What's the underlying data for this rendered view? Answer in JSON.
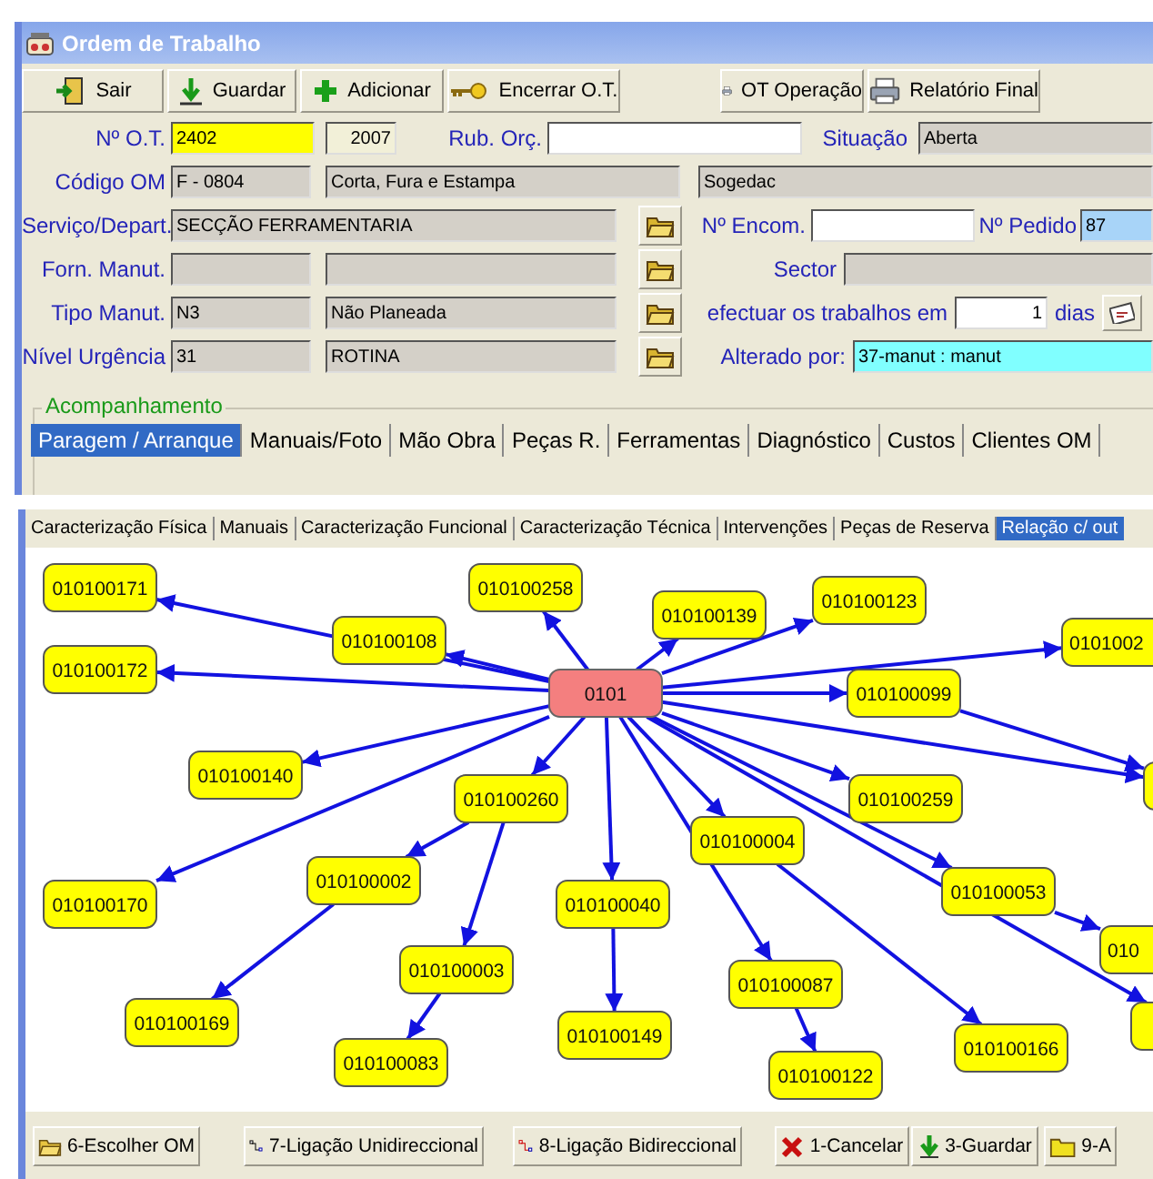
{
  "window": {
    "title": "Ordem de Trabalho"
  },
  "toolbar": [
    {
      "label": "Sair"
    },
    {
      "label": "Guardar"
    },
    {
      "label": "Adicionar"
    },
    {
      "label": "Encerrar O.T."
    },
    {
      "label": "OT Operação"
    },
    {
      "label": "Relatório Final"
    }
  ],
  "form": {
    "ot_number": {
      "label": "Nº O.T.",
      "value": "2402"
    },
    "year": "2007",
    "rub_orc": {
      "label": "Rub. Orç."
    },
    "situacao": {
      "label": "Situação",
      "value": "Aberta"
    },
    "codigo_om": {
      "label": "Código OM",
      "code": "F - 0804",
      "name": "Corta, Fura e Estampa",
      "client": "Sogedac"
    },
    "servico": {
      "label": "Serviço/Depart.",
      "value": "SECÇÃO FERRAMENTARIA"
    },
    "encomenda": {
      "label": "Nº Encom."
    },
    "pedido": {
      "label": "Nº Pedido",
      "value": "87"
    },
    "fornecedor": {
      "label": "Forn. Manut."
    },
    "sector": {
      "label": "Sector"
    },
    "tipo": {
      "label": "Tipo Manut.",
      "code": "N3",
      "name": "Não Planeada"
    },
    "prazo": {
      "label": "efectuar os trabalhos em",
      "value": "1",
      "unit": "dias"
    },
    "urgencia": {
      "label": "Nível Urgência",
      "code": "31",
      "name": "ROTINA"
    },
    "alterado": {
      "label": "Alterado por:",
      "value": "37-manut : manut"
    }
  },
  "tracking": {
    "title": "Acompanhamento",
    "tabs": [
      {
        "label": "Paragem / Arranque",
        "selected": true
      },
      {
        "label": "Manuais/Foto",
        "selected": false
      },
      {
        "label": "Mão Obra",
        "selected": false
      },
      {
        "label": "Peças R.",
        "selected": false
      },
      {
        "label": "Ferramentas",
        "selected": false
      },
      {
        "label": "Diagnóstico",
        "selected": false
      },
      {
        "label": "Custos",
        "selected": false
      },
      {
        "label": "Clientes OM",
        "selected": false
      }
    ]
  },
  "detail_tabs": [
    {
      "label": "Caracterização Física",
      "selected": false
    },
    {
      "label": "Manuais",
      "selected": false
    },
    {
      "label": "Caracterização Funcional",
      "selected": false
    },
    {
      "label": "Caracterização Técnica",
      "selected": false
    },
    {
      "label": "Intervenções",
      "selected": false
    },
    {
      "label": "Peças de Reserva",
      "selected": false
    },
    {
      "label": "Relação c/ out",
      "selected": true
    }
  ],
  "diagram": {
    "nodes": [
      {
        "kind": "root",
        "label": "0101"
      },
      {
        "kind": "node",
        "label": "010100171"
      },
      {
        "kind": "node",
        "label": "010100258"
      },
      {
        "kind": "node",
        "label": "010100139"
      },
      {
        "kind": "node",
        "label": "010100123"
      },
      {
        "kind": "cut",
        "label": "0101002"
      },
      {
        "kind": "node",
        "label": "010100108"
      },
      {
        "kind": "node",
        "label": "010100172"
      },
      {
        "kind": "node",
        "label": "010100099"
      },
      {
        "kind": "node",
        "label": "010100140"
      },
      {
        "kind": "cut"
      },
      {
        "kind": "node",
        "label": "010100260"
      },
      {
        "kind": "node",
        "label": "010100259"
      },
      {
        "kind": "node",
        "label": "010100004"
      },
      {
        "kind": "node",
        "label": "010100002"
      },
      {
        "kind": "node",
        "label": "010100053"
      },
      {
        "kind": "node",
        "label": "010100170"
      },
      {
        "kind": "node",
        "label": "010100040"
      },
      {
        "kind": "cut",
        "label": "010"
      },
      {
        "kind": "node",
        "label": "010100003"
      },
      {
        "kind": "node",
        "label": "010100087"
      },
      {
        "kind": "node",
        "label": "010100169"
      },
      {
        "kind": "node",
        "label": "010100149"
      },
      {
        "kind": "cut"
      },
      {
        "kind": "node",
        "label": "010100166"
      },
      {
        "kind": "node",
        "label": "010100083"
      },
      {
        "kind": "node",
        "label": "010100122"
      }
    ]
  },
  "actions": [
    {
      "label": "6-Escolher OM"
    },
    {
      "label": "7-Ligação Unidireccional"
    },
    {
      "label": "8-Ligação Bidireccional"
    },
    {
      "label": "1-Cancelar"
    },
    {
      "label": "3-Guardar"
    },
    {
      "label": "9-A"
    }
  ]
}
